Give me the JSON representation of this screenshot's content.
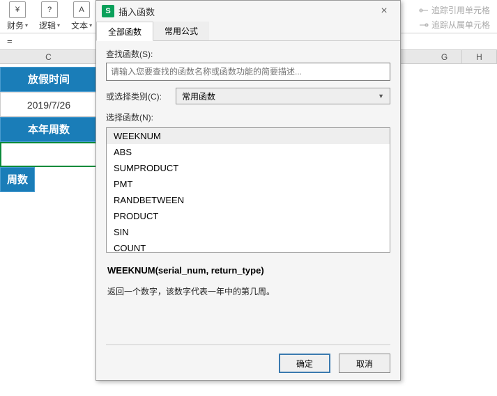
{
  "ribbon": {
    "finance": {
      "label": "财务",
      "icon": "¥"
    },
    "logic": {
      "label": "逻辑",
      "icon": "?"
    },
    "text": {
      "label": "文本",
      "icon": "A"
    }
  },
  "trace": {
    "precedents": "追踪引用单元格",
    "dependents": "追踪从属单元格"
  },
  "formula_bar": {
    "eq": "="
  },
  "columns": {
    "c": "C",
    "g": "G",
    "h": "H"
  },
  "sheet": {
    "holiday_date_label": "放假时间",
    "holiday_date_value": "2019/7/26",
    "year_week_label": "本年周数",
    "week_label": "周数"
  },
  "dialog": {
    "title": "插入函数",
    "close": "×",
    "tabs": {
      "all": "全部函数",
      "common": "常用公式"
    },
    "search_label": "查找函数(S):",
    "search_placeholder": "请输入您要查找的函数名称或函数功能的简要描述...",
    "category_label": "或选择类别(C):",
    "category_value": "常用函数",
    "select_label": "选择函数(N):",
    "functions": [
      "WEEKNUM",
      "ABS",
      "SUMPRODUCT",
      "PMT",
      "RANDBETWEEN",
      "PRODUCT",
      "SIN",
      "COUNT"
    ],
    "signature": "WEEKNUM(serial_num, return_type)",
    "description": "返回一个数字，该数字代表一年中的第几周。",
    "ok": "确定",
    "cancel": "取消"
  }
}
